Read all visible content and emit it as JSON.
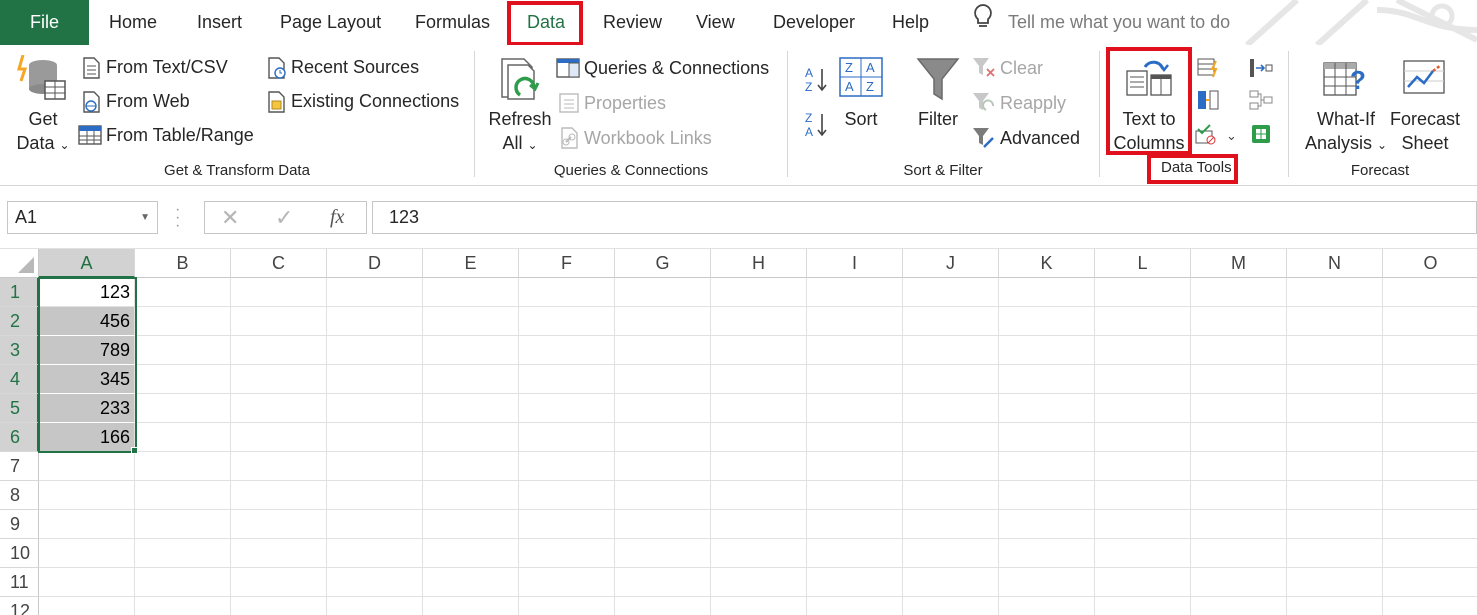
{
  "tabs": {
    "file": "File",
    "home": "Home",
    "insert": "Insert",
    "page_layout": "Page Layout",
    "formulas": "Formulas",
    "data": "Data",
    "review": "Review",
    "view": "View",
    "developer": "Developer",
    "help": "Help",
    "tell_me": "Tell me what you want to do"
  },
  "ribbon": {
    "get_transform": {
      "get_data_line1": "Get",
      "get_data_line2": "Data",
      "from_text_csv": "From Text/CSV",
      "from_web": "From Web",
      "from_table_range": "From Table/Range",
      "recent_sources": "Recent Sources",
      "existing_connections": "Existing Connections",
      "group_label": "Get & Transform Data"
    },
    "queries": {
      "refresh_line1": "Refresh",
      "refresh_line2": "All",
      "queries_connections": "Queries & Connections",
      "properties": "Properties",
      "workbook_links": "Workbook Links",
      "group_label": "Queries & Connections"
    },
    "sort_filter": {
      "sort": "Sort",
      "filter": "Filter",
      "clear": "Clear",
      "reapply": "Reapply",
      "advanced": "Advanced",
      "group_label": "Sort & Filter"
    },
    "data_tools": {
      "text_to_line1": "Text to",
      "text_to_line2": "Columns",
      "group_label": "Data Tools"
    },
    "forecast": {
      "what_if_line1": "What-If",
      "what_if_line2": "Analysis",
      "forecast_line1": "Forecast",
      "forecast_line2": "Sheet",
      "group_label": "Forecast"
    }
  },
  "formula_bar": {
    "name_box": "A1",
    "fx": "fx",
    "value": "123"
  },
  "sheet": {
    "columns": [
      "A",
      "B",
      "C",
      "D",
      "E",
      "F",
      "G",
      "H",
      "I",
      "J",
      "K",
      "L",
      "M",
      "N",
      "O"
    ],
    "rows": [
      "1",
      "2",
      "3",
      "4",
      "5",
      "6",
      "7",
      "8",
      "9",
      "10",
      "11",
      "12"
    ],
    "column_a_values": [
      "123",
      "456",
      "789",
      "345",
      "233",
      "166"
    ]
  },
  "colors": {
    "excel_green": "#217346",
    "highlight_red": "#e0101c"
  }
}
